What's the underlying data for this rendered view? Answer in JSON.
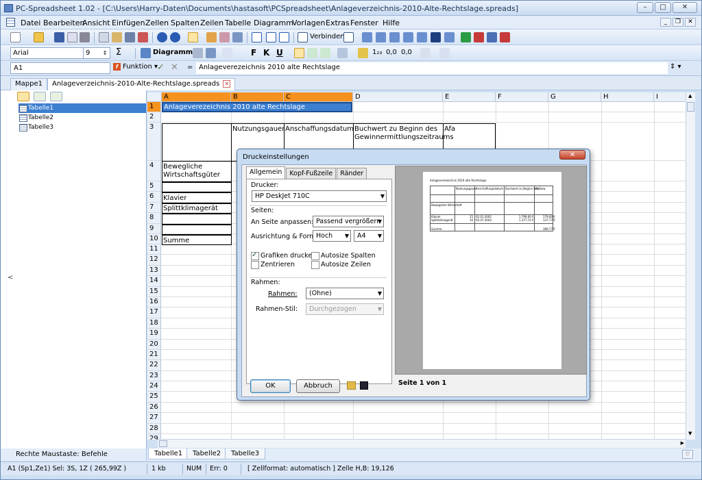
{
  "window": {
    "title": "PC-Spreadsheet 1.02 - [C:\\Users\\Harry-Daten\\Documents\\hastasoft\\PCSpreadsheet\\Anlageverzeichnis-2010-Alte-Rechtslage.spreads]"
  },
  "menu": [
    "Datei",
    "Bearbeiten",
    "Ansicht",
    "Einfügen",
    "Zellen",
    "Spalten",
    "Zeilen",
    "Tabelle",
    "Diagramm",
    "Vorlagen",
    "Extras",
    "Fenster",
    "Hilfe"
  ],
  "toolbar": {
    "merge_label": "Verbinden",
    "font_name": "Arial",
    "font_size": "9",
    "chart_label": "Diagramm",
    "bold": "F",
    "italic": "K",
    "underline": "U",
    "sum": "Σ"
  },
  "formula": {
    "cell_ref": "A1",
    "function_label": "Funktion",
    "equals": "=",
    "value": "Anlageverezeichnis 2010 alte Rechtslage"
  },
  "doc_tabs": [
    "Mappe1",
    "Anlageverzeichnis-2010-Alte-Rechtslage.spreads"
  ],
  "tree": [
    "Tabelle1",
    "Tabelle2",
    "Tabelle3"
  ],
  "grid": {
    "columns": [
      "A",
      "B",
      "C",
      "D",
      "E",
      "F",
      "G",
      "H",
      "I"
    ],
    "rows": [
      "1",
      "2",
      "3",
      "4",
      "5",
      "6",
      "7",
      "8",
      "9",
      "10",
      "11",
      "12",
      "13",
      "14",
      "15",
      "16",
      "17",
      "18",
      "19",
      "20",
      "21",
      "22",
      "23",
      "24",
      "25",
      "26",
      "27",
      "28",
      "29"
    ],
    "cells": {
      "a1": "Anlageverezeichnis 2010 alte Rechtslage",
      "b3": "Nutzungsgauer",
      "c3": "Anschaffungsdatum",
      "d3_line1": "Buchwert zu Beginn des",
      "d3_line2": "Gewinnermittlungszeitraums",
      "e3": "Afa",
      "a4_line1": "Bewegliche",
      "a4_line2": "Wirtschaftsgüter",
      "a6": "Klavier",
      "a7": "Splittklimagerät",
      "a10": "Summe"
    }
  },
  "left_status": "Rechte Maustaste: Befehle",
  "sheet_tabs": [
    "Tabelle1",
    "Tabelle2",
    "Tabelle3"
  ],
  "statusbar": {
    "pos": "A1 (Sp1,Ze1) Sel: 3S, 1Z ( 265,99Z )",
    "size": "1 kb",
    "num": "NUM",
    "err": "Err: 0",
    "info": "[ Zellformat: automatisch ] Zelle H,B: 19,126"
  },
  "dialog": {
    "title": "Druckeinstellungen",
    "tabs": [
      "Allgemein",
      "Kopf-Fußzeile",
      "Ränder"
    ],
    "printer_label": "Drucker:",
    "printer": "HP DeskJet 710C",
    "pages_label": "Seiten:",
    "fit_label": "An Seite anpassen:",
    "fit_value": "Passend vergrößern",
    "orient_label": "Ausrichtung & Format:",
    "orient_value": "Hoch",
    "format_value": "A4",
    "chk_graphics": "Grafiken drucken",
    "chk_center": "Zentrieren",
    "chk_autocols": "Autosize Spalten",
    "chk_autorows": "Autosize Zeilen",
    "frame_label": "Rahmen:",
    "frame_field": "Rahmen:",
    "frame_value": "(Ohne)",
    "frame_style_label": "Rahmen-Stil:",
    "frame_style_value": "Durchgezogen",
    "ok": "OK",
    "cancel": "Abbruch",
    "page_info": "Seite 1 von 1",
    "preview": {
      "title": "Anlageverezeichnis 2010 alte Rechtslage",
      "h1": "Nutzungsgauer",
      "h2": "Anschaffungsdatum",
      "h3": "Buchwert zu Beginn des Gew",
      "h4": "Afa",
      "r1": "Bewegliche Wirtschaft",
      "r2a": "Klavier",
      "r2b": "15",
      "r2c": "02.01.2002",
      "r2d": "1.799,00 €",
      "r2e": "179,00 €",
      "r3a": "Splittklimagerät",
      "r3b": "10",
      "r3c": "05.07.2003",
      "r3d": "1.377,72 €",
      "r3e": "137,77 €",
      "r4a": "Summe",
      "r4e": "389,77 €"
    }
  }
}
